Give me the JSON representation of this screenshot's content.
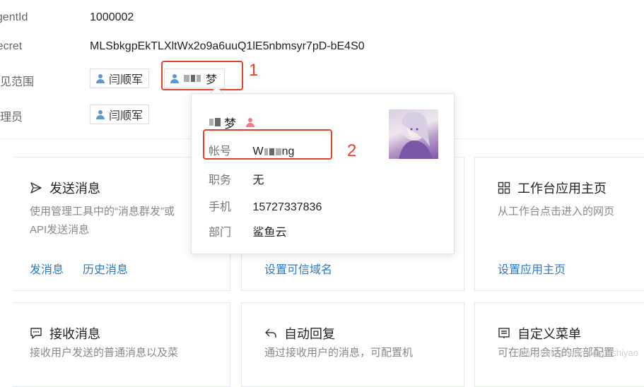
{
  "info": {
    "agentid_label": "agentId",
    "agentid_value": "1000002",
    "secret_label": "Secret",
    "secret_value": "MLSbkgpEkTLXltWx2o9a6uuQ1lE5nbmsyr7pD-bE4S0",
    "visible_label": "可见范围",
    "visible_user1": "闫顺军",
    "visible_user2_suffix": "梦",
    "admin_label": "管理员",
    "admin_user": "闫顺军"
  },
  "annotations": {
    "one": "1",
    "two": "2"
  },
  "popup": {
    "name_suffix": "梦",
    "account_label": "帐号",
    "account_prefix": "W",
    "account_suffix": "ng",
    "position_label": "职务",
    "position_value": "无",
    "phone_label": "手机",
    "phone_value": "15727337836",
    "dept_label": "部门",
    "dept_value": "鲨鱼云"
  },
  "cards": {
    "send": {
      "title": "发送消息",
      "desc1": "使用管理工具中的“消息群发”或",
      "desc2": "API发送消息",
      "link1": "发消息",
      "link2": "历史消息"
    },
    "trusted": {
      "link": "设置可信域名"
    },
    "workbench": {
      "title": "工作台应用主页",
      "desc1": "从工作台点击进入的网页",
      "link": "设置应用主页"
    },
    "receive": {
      "title": "接收消息",
      "desc1": "接收用户发送的普通消息以及菜"
    },
    "autoreply": {
      "title": "自动回复",
      "desc1": "通过接收用户的消息，可配置机"
    },
    "menu": {
      "title": "自定义菜单",
      "desc1": "可在应用会话的底部配置"
    }
  },
  "watermark": "https://blog.csdn.net/jiushiyao"
}
